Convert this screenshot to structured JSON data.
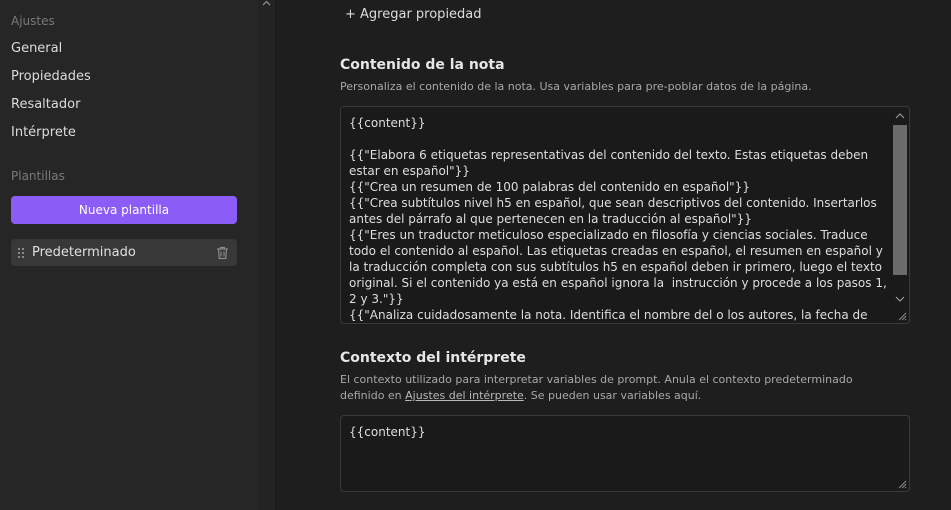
{
  "sidebar": {
    "settings_heading": "Ajustes",
    "settings_items": [
      {
        "label": "General"
      },
      {
        "label": "Propiedades"
      },
      {
        "label": "Resaltador"
      },
      {
        "label": "Intérprete"
      }
    ],
    "templates_heading": "Plantillas",
    "new_template_label": "Nueva plantilla",
    "templates": [
      {
        "label": "Predeterminado"
      }
    ]
  },
  "main": {
    "add_property_label": "+ Agregar propiedad",
    "note_content": {
      "title": "Contenido de la nota",
      "description": "Personaliza el contenido de la nota. Usa variables para pre-poblar datos de la página.",
      "value_lines": [
        "{{content}}",
        "",
        "{{\"Elabora 6 etiquetas representativas del contenido del texto. Estas etiquetas deben estar en español\"}}",
        "{{\"Crea un resumen de 100 palabras del contenido en español\"}}",
        "{{\"Crea subtítulos nivel h5 en español, que sean descriptivos del contenido. Insertarlos antes del párrafo al que pertenecen en la traducción al español\"}}",
        "{{\"Eres un traductor meticuloso especializado en filosofía y ciencias sociales. Traduce todo el contenido al español. Las etiquetas creadas en español, el resumen en español y la traducción completa con sus subtítulos h5 en español deben ir primero, luego el texto original. Si el contenido ya está en español ignora la  instrucción y procede a los pasos 1, 2 y 3.\"}}",
        "{{\"Analiza cuidadosamente la nota. Identifica el nombre del o los autores, la fecha de publicación, el nombre del artículo, la editorial u organización que publica y el DOI si es que existe. Con esta"
      ]
    },
    "interpreter_context": {
      "title": "Contexto del intérprete",
      "description_before": "El contexto utilizado para interpretar variables de prompt. Anula el contexto predeterminado definido en ",
      "description_link": "Ajustes del intérprete",
      "description_after": ". Se pueden usar variables aquí.",
      "value": "{{content}}"
    }
  },
  "colors": {
    "accent": "#8b5cf6",
    "background": "#1e1e1e",
    "sidebar": "#262626"
  }
}
